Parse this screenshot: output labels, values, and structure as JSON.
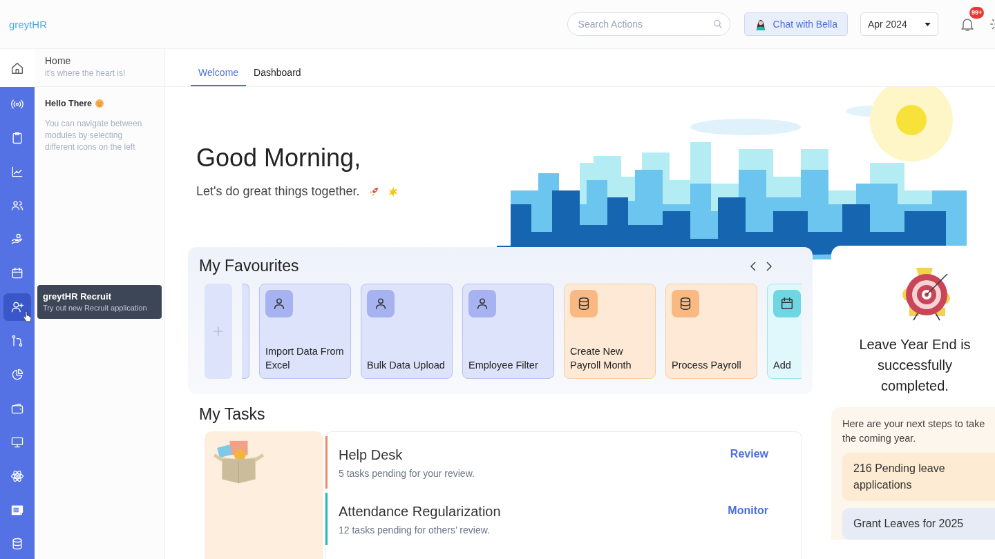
{
  "app": {
    "logo": "greytHR"
  },
  "header": {
    "search": {
      "placeholder": "Search Actions"
    },
    "chat_button": "Chat with Bella",
    "month_select": "Apr 2024",
    "notification_badge": "99+"
  },
  "rail": {
    "home": {
      "selected": false
    },
    "items": [
      {
        "selected": false
      },
      {
        "selected": false
      },
      {
        "selected": false
      },
      {
        "selected": false
      },
      {
        "selected": false
      },
      {
        "selected": false
      },
      {
        "selected": true
      },
      {
        "selected": false
      },
      {
        "selected": false
      },
      {
        "selected": false
      },
      {
        "selected": false
      },
      {
        "selected": false
      },
      {
        "selected": false
      },
      {
        "selected": false
      }
    ]
  },
  "tooltip": {
    "title": "greytHR Recruit",
    "text": "Try out new Recruit application"
  },
  "side_panel": {
    "title": "Home",
    "subtitle": "it's where the heart is!",
    "greeting": "Hello There",
    "text": "You can navigate between modules by selecting different icons on the left"
  },
  "tabs": [
    {
      "label": "Welcome",
      "selected": true
    },
    {
      "label": "Dashboard",
      "selected": false
    }
  ],
  "hero": {
    "heading": "Good Morning,",
    "subtitle": "Let's do great things together."
  },
  "favourites": {
    "title": "My Favourites",
    "cards": [
      {
        "label": "Import Data From Excel",
        "kind": "people"
      },
      {
        "label": "Bulk Data Upload",
        "kind": "people"
      },
      {
        "label": "Employee Filter",
        "kind": "people"
      },
      {
        "label": "Create New Payroll Month",
        "kind": "database"
      },
      {
        "label": "Process Payroll",
        "kind": "database"
      },
      {
        "label": "Add",
        "kind": "calendar"
      }
    ]
  },
  "tasks": {
    "title": "My Tasks",
    "items": [
      {
        "title": "Help Desk",
        "text": "5 tasks pending for your review.",
        "action": "Review",
        "color": "#f08a6c"
      },
      {
        "title": "Attendance Regularization",
        "text": "12 tasks pending for others’ review.",
        "action": "Monitor",
        "color": "#22b8c0"
      }
    ]
  },
  "leave_card": {
    "heading": "Leave Year End is successfully completed.",
    "intro": "Here are your next steps to take the coming year.",
    "steps": [
      {
        "label": "216 Pending leave applications",
        "kind": "pending"
      },
      {
        "label": "Grant Leaves for 2025",
        "kind": "grant"
      }
    ]
  }
}
